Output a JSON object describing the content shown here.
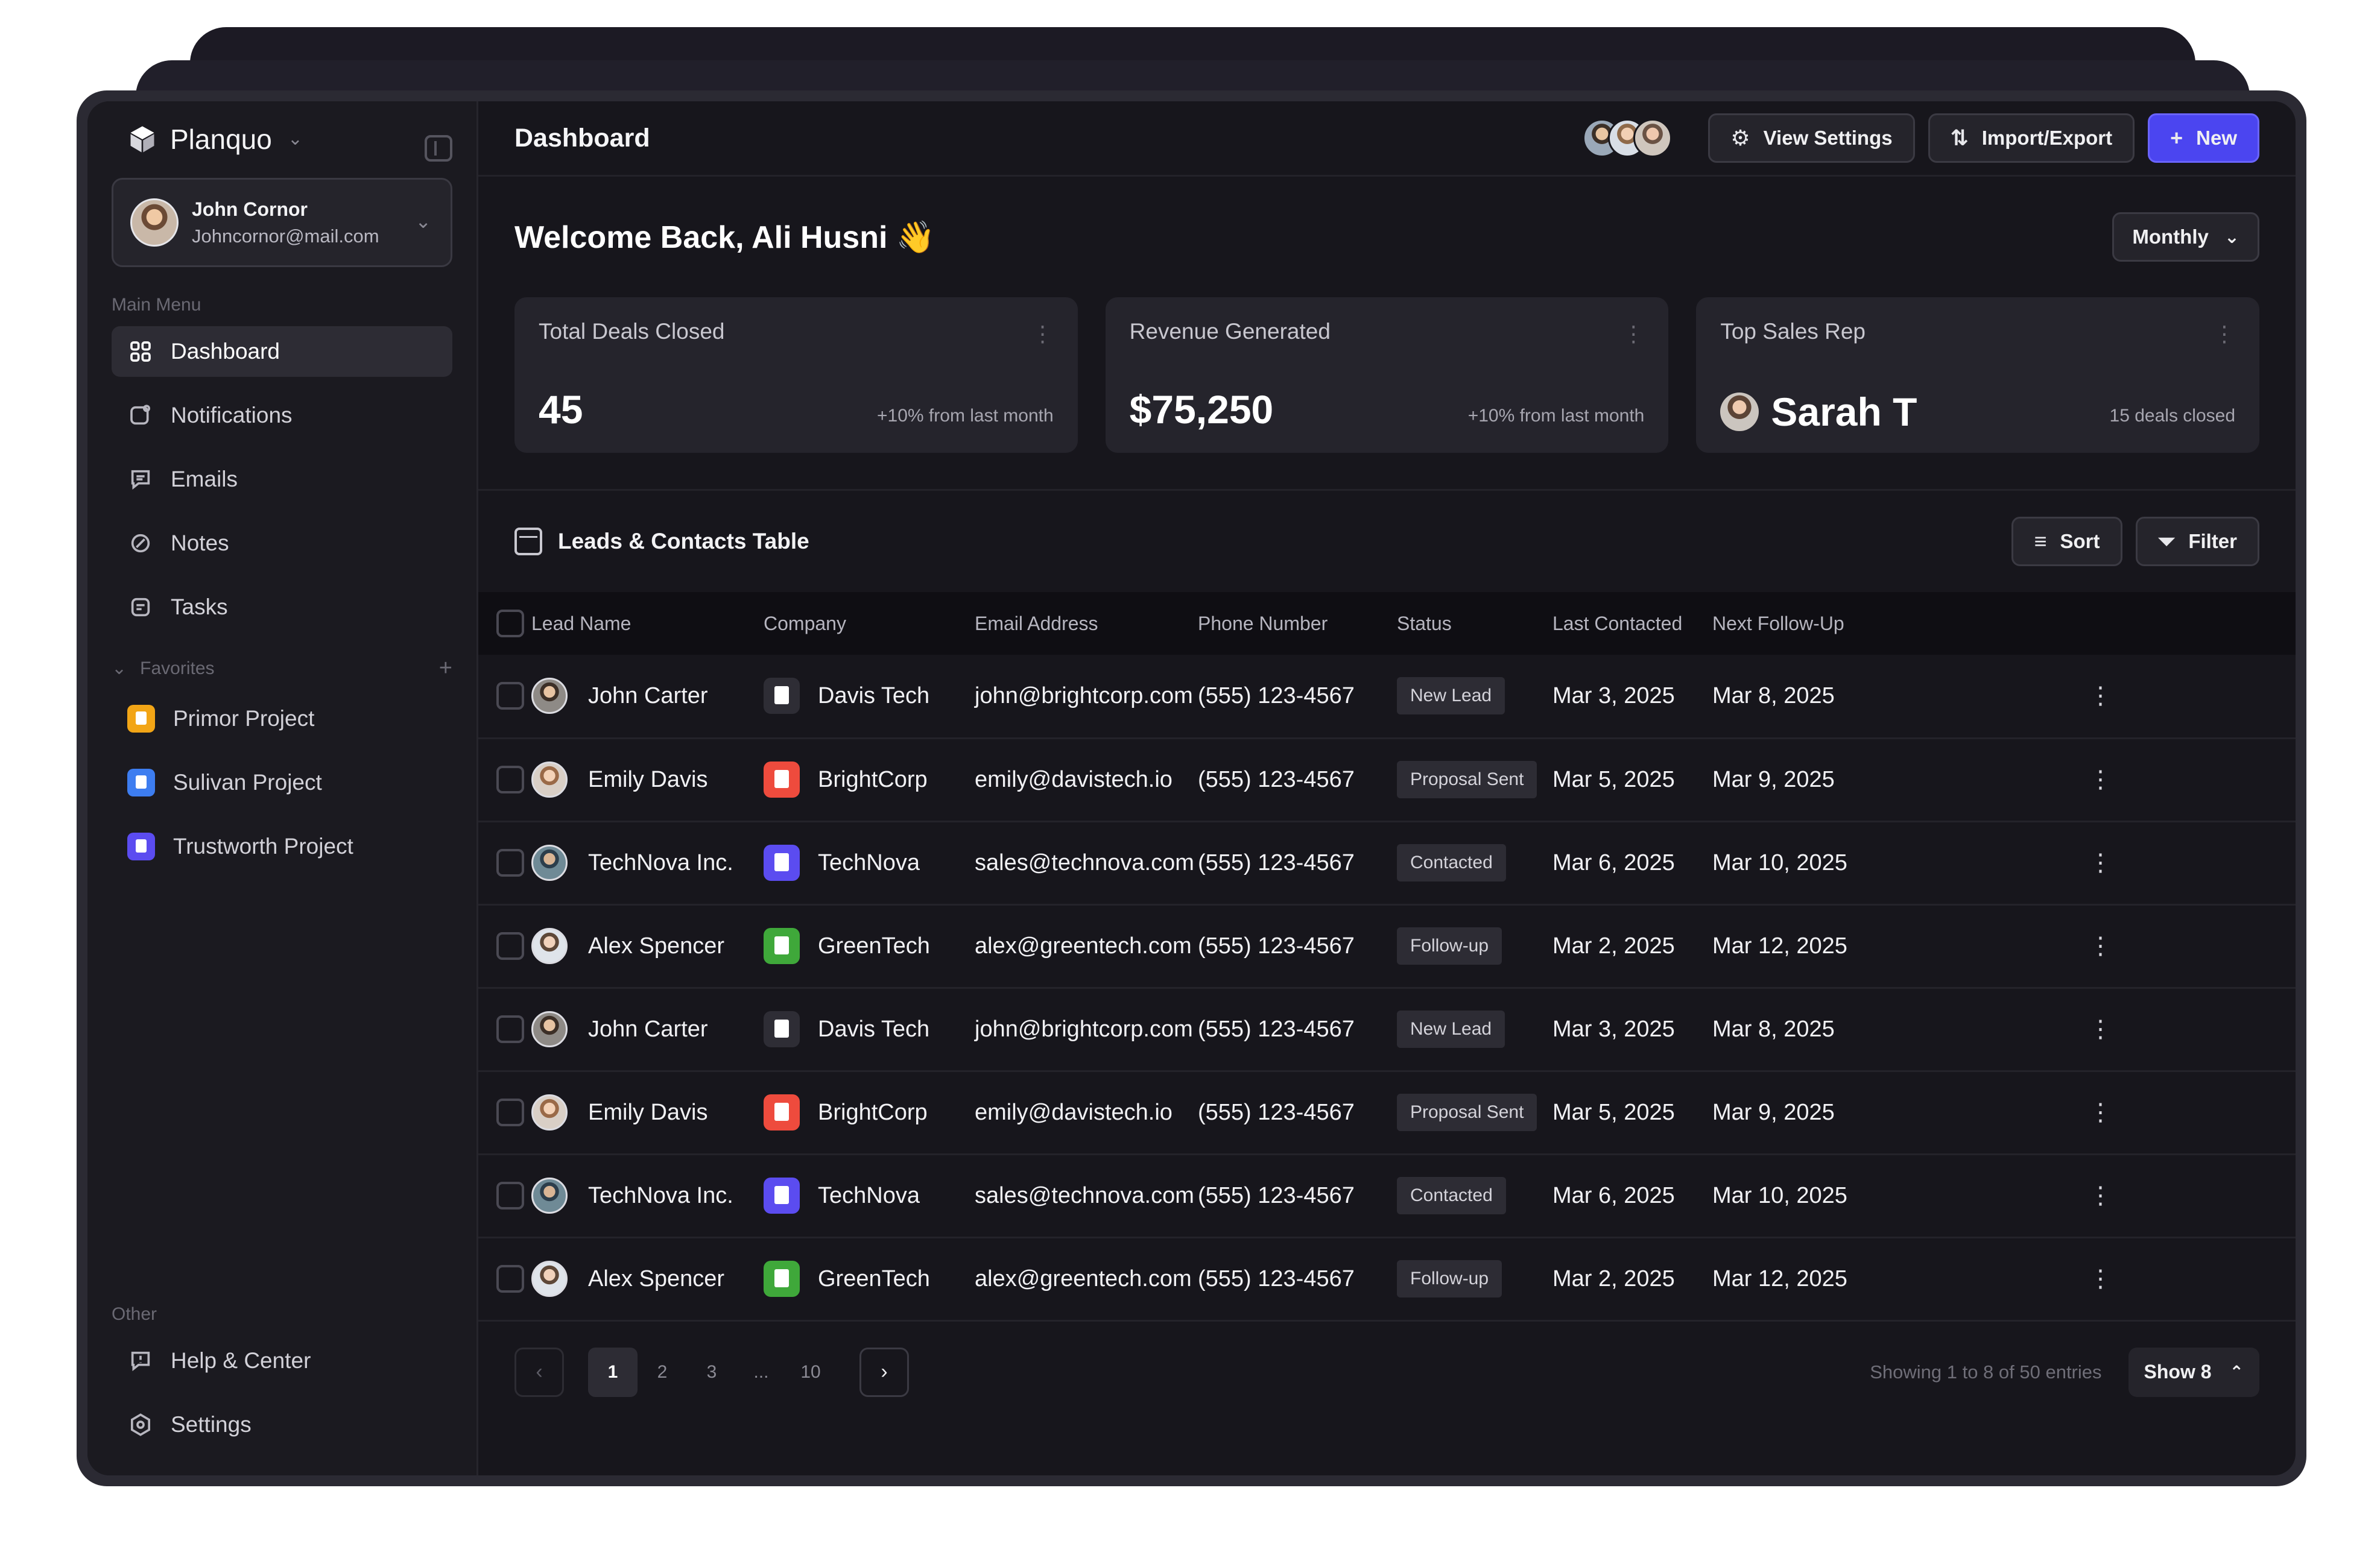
{
  "app": {
    "name": "Planquo"
  },
  "user": {
    "name": "John Cornor",
    "email": "Johncornor@mail.com"
  },
  "sidebar": {
    "main_menu_label": "Main Menu",
    "items": [
      {
        "label": "Dashboard",
        "icon": "grid-icon",
        "active": true
      },
      {
        "label": "Notifications",
        "icon": "bell-icon"
      },
      {
        "label": "Emails",
        "icon": "mail-icon"
      },
      {
        "label": "Notes",
        "icon": "note-icon"
      },
      {
        "label": "Tasks",
        "icon": "task-icon"
      }
    ],
    "favorites_label": "Favorites",
    "favorites": [
      {
        "label": "Primor Project",
        "color": "#f2a516"
      },
      {
        "label": "Sulivan Project",
        "color": "#3d7df0"
      },
      {
        "label": "Trustworth Project",
        "color": "#5b4cf0"
      }
    ],
    "other_label": "Other",
    "other": [
      {
        "label": "Help & Center",
        "icon": "help-icon"
      },
      {
        "label": "Settings",
        "icon": "settings-icon"
      }
    ]
  },
  "header": {
    "title": "Dashboard",
    "view_settings": "View Settings",
    "import_export": "Import/Export",
    "new": "New"
  },
  "welcome": {
    "text": "Welcome Back, Ali Husni 👋",
    "period": "Monthly"
  },
  "stats": [
    {
      "title": "Total Deals Closed",
      "value": "45",
      "note": "+10% from last month"
    },
    {
      "title": "Revenue Generated",
      "value": "$75,250",
      "note": "+10% from last month"
    },
    {
      "title": "Top Sales Rep",
      "value": "Sarah T",
      "note": "15 deals closed"
    }
  ],
  "table": {
    "title": "Leads & Contacts Table",
    "sort": "Sort",
    "filter": "Filter",
    "columns": [
      "Lead Name",
      "Company",
      "Email Address",
      "Phone Number",
      "Status",
      "Last Contacted",
      "Next Follow-Up"
    ],
    "rows": [
      {
        "lead": "John Carter",
        "company": "Davis Tech",
        "company_color": "#2e2d35",
        "email": "john@brightcorp.com",
        "phone": "(555) 123-4567",
        "status": "New Lead",
        "last": "Mar 3, 2025",
        "next": "Mar 8, 2025"
      },
      {
        "lead": "Emily Davis",
        "company": "BrightCorp",
        "company_color": "#ee4b3d",
        "email": "emily@davistech.io",
        "phone": "(555) 123-4567",
        "status": "Proposal Sent",
        "last": "Mar 5, 2025",
        "next": "Mar 9, 2025"
      },
      {
        "lead": "TechNova Inc.",
        "company": "TechNova",
        "company_color": "#5b4cf0",
        "email": "sales@technova.com",
        "phone": "(555) 123-4567",
        "status": "Contacted",
        "last": "Mar 6, 2025",
        "next": "Mar 10, 2025"
      },
      {
        "lead": "Alex Spencer",
        "company": "GreenTech",
        "company_color": "#3fa83a",
        "email": "alex@greentech.com",
        "phone": "(555) 123-4567",
        "status": "Follow-up",
        "last": "Mar 2, 2025",
        "next": "Mar 12, 2025"
      },
      {
        "lead": "John Carter",
        "company": "Davis Tech",
        "company_color": "#2e2d35",
        "email": "john@brightcorp.com",
        "phone": "(555) 123-4567",
        "status": "New Lead",
        "last": "Mar 3, 2025",
        "next": "Mar 8, 2025"
      },
      {
        "lead": "Emily Davis",
        "company": "BrightCorp",
        "company_color": "#ee4b3d",
        "email": "emily@davistech.io",
        "phone": "(555) 123-4567",
        "status": "Proposal Sent",
        "last": "Mar 5, 2025",
        "next": "Mar 9, 2025"
      },
      {
        "lead": "TechNova Inc.",
        "company": "TechNova",
        "company_color": "#5b4cf0",
        "email": "sales@technova.com",
        "phone": "(555) 123-4567",
        "status": "Contacted",
        "last": "Mar 6, 2025",
        "next": "Mar 10, 2025"
      },
      {
        "lead": "Alex Spencer",
        "company": "GreenTech",
        "company_color": "#3fa83a",
        "email": "alex@greentech.com",
        "phone": "(555) 123-4567",
        "status": "Follow-up",
        "last": "Mar 2, 2025",
        "next": "Mar 12, 2025"
      }
    ]
  },
  "pagination": {
    "pages": [
      "1",
      "2",
      "3",
      "...",
      "10"
    ],
    "current": "1",
    "showing": "Showing 1 to 8 of 50 entries",
    "show": "Show 8"
  }
}
